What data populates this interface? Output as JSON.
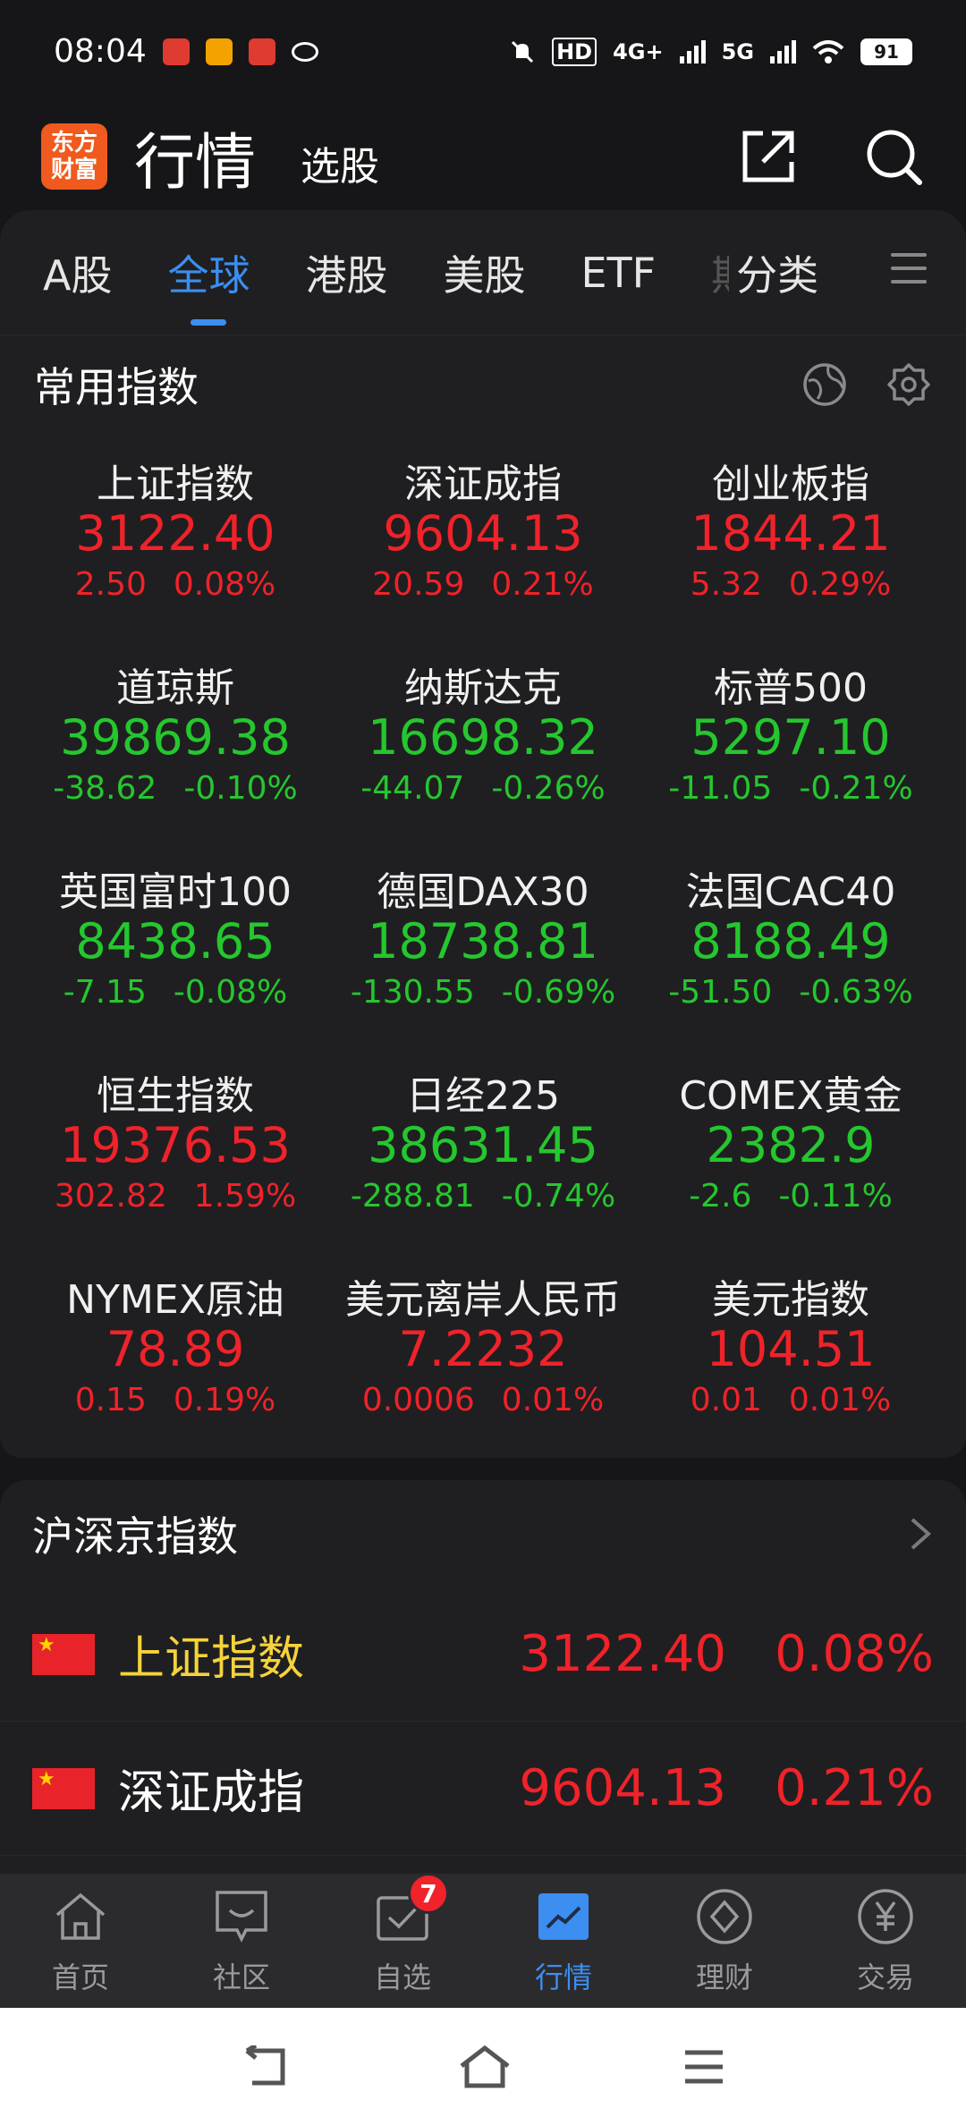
{
  "status_bar": {
    "time": "08:04",
    "network_hd": "HD",
    "network_4g": "4G+",
    "network_5g": "5G",
    "battery": "91"
  },
  "header": {
    "logo_text": "东方财富",
    "title": "行情",
    "stock_picker": "选股",
    "icons": [
      "share-icon",
      "search-icon"
    ]
  },
  "tabs": [
    {
      "label": "A股",
      "active": false
    },
    {
      "label": "全球",
      "active": true
    },
    {
      "label": "港股",
      "active": false
    },
    {
      "label": "美股",
      "active": false
    },
    {
      "label": "ETF",
      "active": false
    },
    {
      "label": "期",
      "active": false
    },
    {
      "label": "分类",
      "active": false
    }
  ],
  "common_indices": {
    "title": "常用指数",
    "items": [
      {
        "name": "上证指数",
        "price": "3122.40",
        "change": "2.50",
        "pct": "0.08%",
        "trend": "up"
      },
      {
        "name": "深证成指",
        "price": "9604.13",
        "change": "20.59",
        "pct": "0.21%",
        "trend": "up"
      },
      {
        "name": "创业板指",
        "price": "1844.21",
        "change": "5.32",
        "pct": "0.29%",
        "trend": "up"
      },
      {
        "name": "道琼斯",
        "price": "39869.38",
        "change": "-38.62",
        "pct": "-0.10%",
        "trend": "down"
      },
      {
        "name": "纳斯达克",
        "price": "16698.32",
        "change": "-44.07",
        "pct": "-0.26%",
        "trend": "down"
      },
      {
        "name": "标普500",
        "price": "5297.10",
        "change": "-11.05",
        "pct": "-0.21%",
        "trend": "down"
      },
      {
        "name": "英国富时100",
        "price": "8438.65",
        "change": "-7.15",
        "pct": "-0.08%",
        "trend": "down"
      },
      {
        "name": "德国DAX30",
        "price": "18738.81",
        "change": "-130.55",
        "pct": "-0.69%",
        "trend": "down"
      },
      {
        "name": "法国CAC40",
        "price": "8188.49",
        "change": "-51.50",
        "pct": "-0.63%",
        "trend": "down"
      },
      {
        "name": "恒生指数",
        "price": "19376.53",
        "change": "302.82",
        "pct": "1.59%",
        "trend": "up"
      },
      {
        "name": "日经225",
        "price": "38631.45",
        "change": "-288.81",
        "pct": "-0.74%",
        "trend": "down"
      },
      {
        "name": "COMEX黄金",
        "price": "2382.9",
        "change": "-2.6",
        "pct": "-0.11%",
        "trend": "down"
      },
      {
        "name": "NYMEX原油",
        "price": "78.89",
        "change": "0.15",
        "pct": "0.19%",
        "trend": "up"
      },
      {
        "name": "美元离岸人民币",
        "price": "7.2232",
        "change": "0.0006",
        "pct": "0.01%",
        "trend": "up"
      },
      {
        "name": "美元指数",
        "price": "104.51",
        "change": "0.01",
        "pct": "0.01%",
        "trend": "up"
      }
    ]
  },
  "hs_indices": {
    "title": "沪深京指数",
    "rows": [
      {
        "name": "上证指数",
        "price": "3122.40",
        "pct": "0.08%",
        "highlight": true
      },
      {
        "name": "深证成指",
        "price": "9604.13",
        "pct": "0.21%",
        "highlight": false
      }
    ]
  },
  "bottom_nav": [
    {
      "label": "首页",
      "icon": "home-icon",
      "active": false
    },
    {
      "label": "社区",
      "icon": "chat-icon",
      "active": false
    },
    {
      "label": "自选",
      "icon": "watchlist-icon",
      "active": false,
      "badge": "7"
    },
    {
      "label": "行情",
      "icon": "chart-icon",
      "active": true
    },
    {
      "label": "理财",
      "icon": "diamond-icon",
      "active": false
    },
    {
      "label": "交易",
      "icon": "yuan-icon",
      "active": false
    }
  ],
  "colors": {
    "up": "#f0222a",
    "down": "#25c72e",
    "accent": "#3c8ef0",
    "brand": "#f05a1e"
  }
}
